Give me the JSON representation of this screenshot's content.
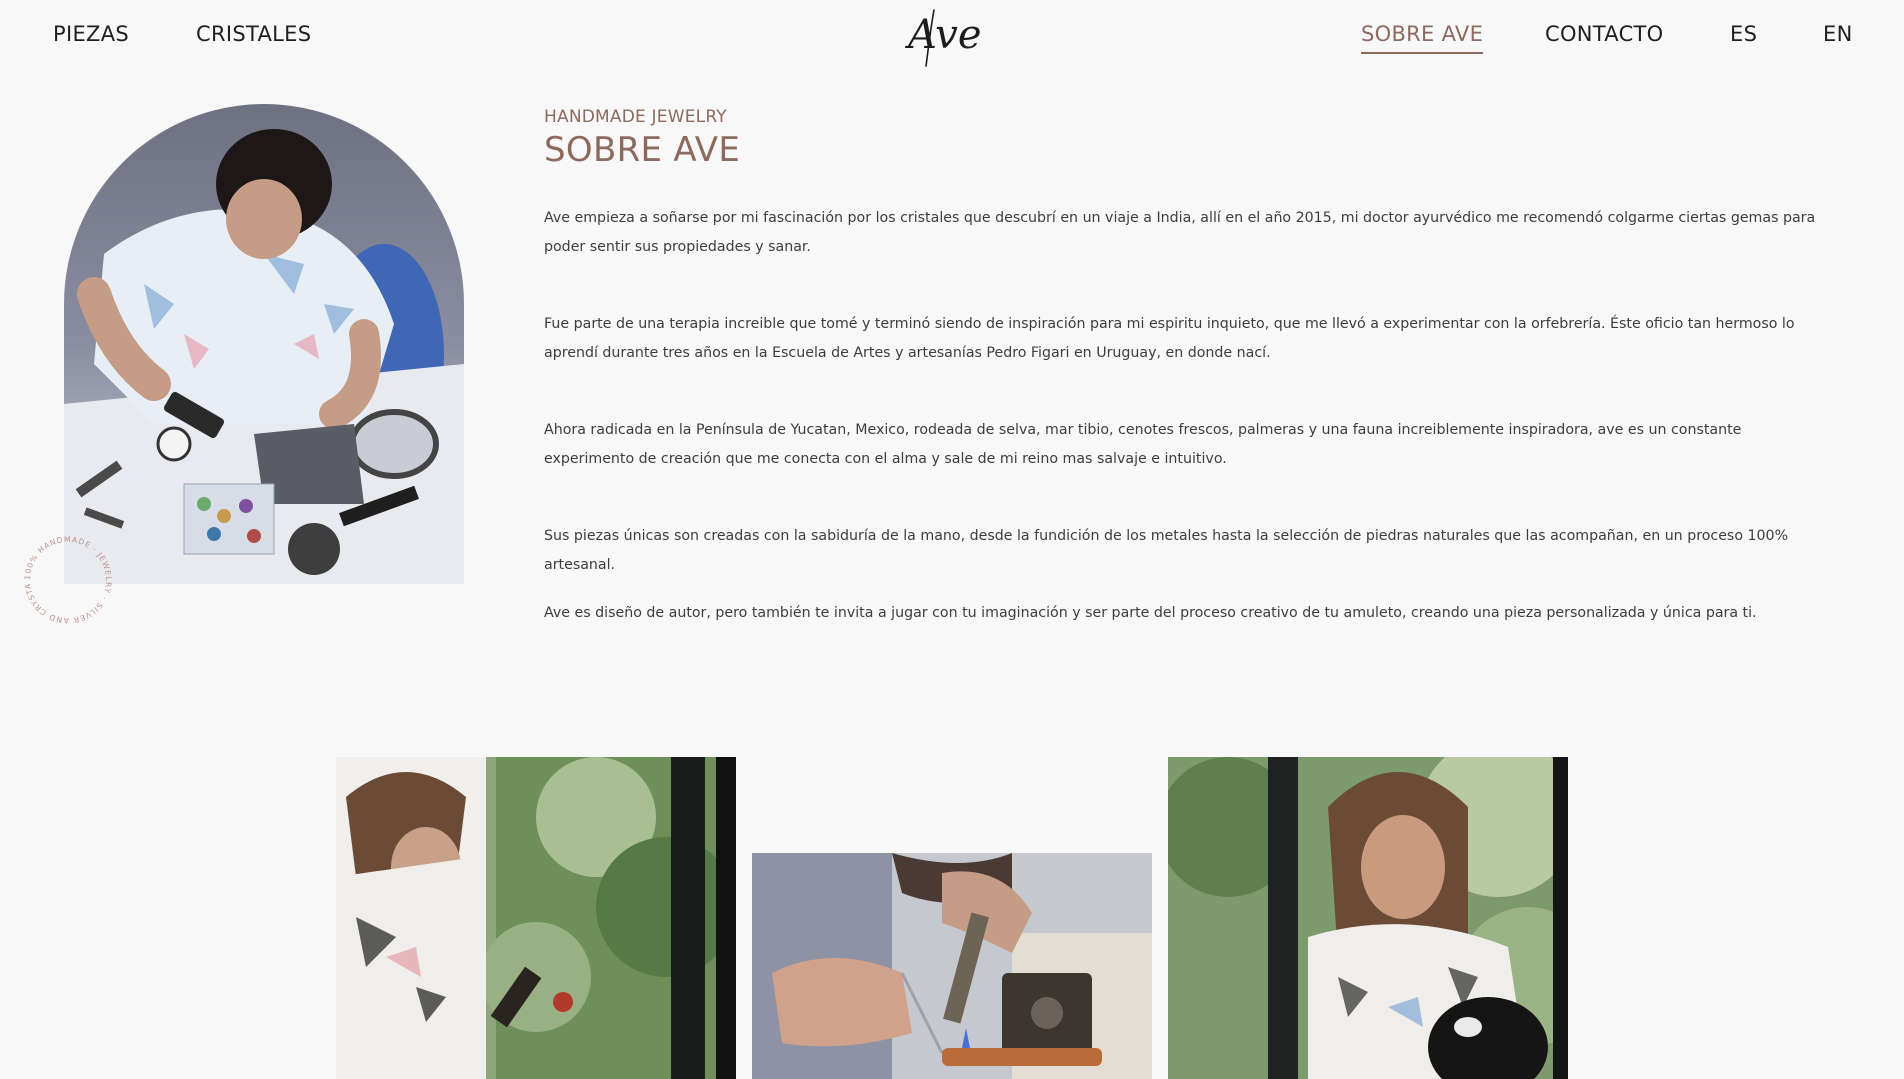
{
  "nav": {
    "left": [
      "PIEZAS",
      "CRISTALES"
    ],
    "right": [
      "SOBRE AVE",
      "CONTACTO"
    ],
    "languages": [
      "ES",
      "EN"
    ],
    "active": "SOBRE AVE"
  },
  "logo": {
    "text": "Ave"
  },
  "about": {
    "eyebrow": "HANDMADE JEWELRY",
    "title": "SOBRE AVE",
    "paragraphs": [
      "Ave empieza a soñarse por mi fascinación por los cristales que descubrí en un viaje a India, allí en el año 2015, mi doctor ayurvédico me recomendó colgarme ciertas gemas para poder sentir sus propiedades y sanar.",
      "Fue parte de una terapia increible que tomé y terminó siendo de inspiración para mi espiritu inquieto, que me llevó a experimentar con la orfebrería. Éste oficio tan hermoso lo aprendí durante tres años en la Escuela de Artes y artesanías Pedro Figari en Uruguay, en donde nací.",
      "Ahora radicada en la Península de Yucatan, Mexico, rodeada de selva, mar tibio, cenotes frescos, palmeras y una fauna increiblemente inspiradora, ave es un constante experimento de creación que me conecta con el alma y sale de mi reino mas salvaje e intuitivo.",
      "Sus piezas únicas son creadas con la sabiduría de la mano, desde la fundición de los metales hasta la selección de piedras naturales que las acompañan, en un proceso 100% artesanal.",
      "Ave es diseño de autor, pero también te invita a jugar con tu imaginación y ser parte del proceso creativo de tu amuleto, creando una pieza personalizada y única para ti."
    ]
  },
  "badge": {
    "text": "100% HANDMADE · JEWELRY · SILVER AND CRYSTALS · "
  },
  "colors": {
    "accent": "#8c6a5e",
    "background": "#f8f8f8",
    "text": "#3d3d3d"
  }
}
